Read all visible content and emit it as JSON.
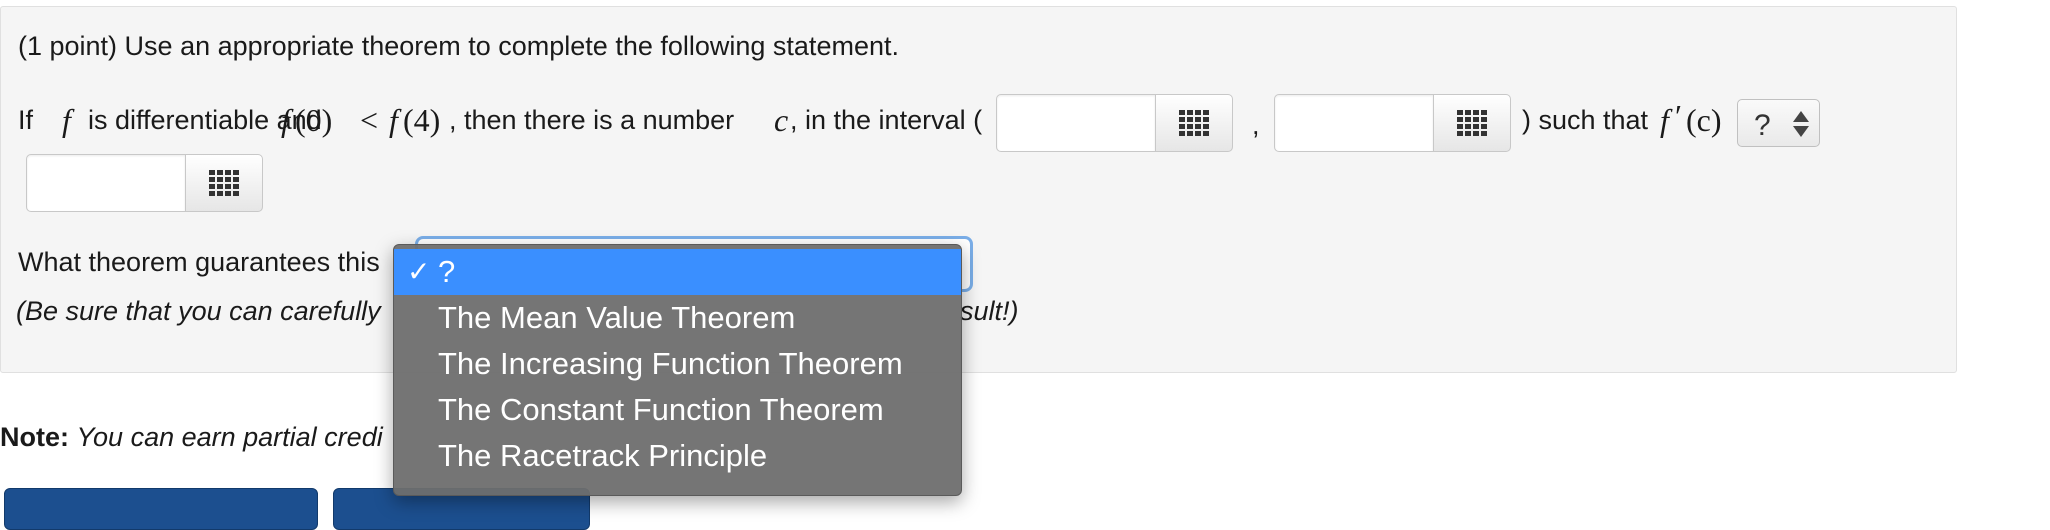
{
  "problem": {
    "header": "(1 point) Use an appropriate theorem to complete the following statement.",
    "statement": {
      "if_word": "If",
      "f_var": "f",
      "is_diff": "is differentiable and",
      "f0": "f",
      "paren0": "(0)",
      "lt": "<",
      "f4": "f",
      "paren4": "(4)",
      "then_text": ", then there is a number",
      "c_var": "c",
      "interval_text": ", in the interval (",
      "comma": ",",
      "such_that": ") such that",
      "fprime": "f",
      "prime": "′",
      "paren_c": "(c)"
    },
    "relation_select": {
      "value": "?"
    },
    "question": "What theorem guarantees this",
    "hint_left": "(Be sure that you can carefully",
    "hint_right": "sult!)"
  },
  "dropdown": {
    "checkmark": "✓",
    "items": [
      "?",
      "The Mean Value Theorem",
      "The Increasing Function Theorem",
      "The Constant Function Theorem",
      "The Racetrack Principle"
    ],
    "selected_index": 0
  },
  "note": {
    "bold": "Note:",
    "text": "You can earn partial credi"
  },
  "colors": {
    "panel_bg": "#f5f5f5",
    "select_focus": "#7aaee8",
    "menu_bg": "#6e6e6e",
    "menu_selected": "#3a8fff",
    "button_bg": "#1c4f8f"
  }
}
